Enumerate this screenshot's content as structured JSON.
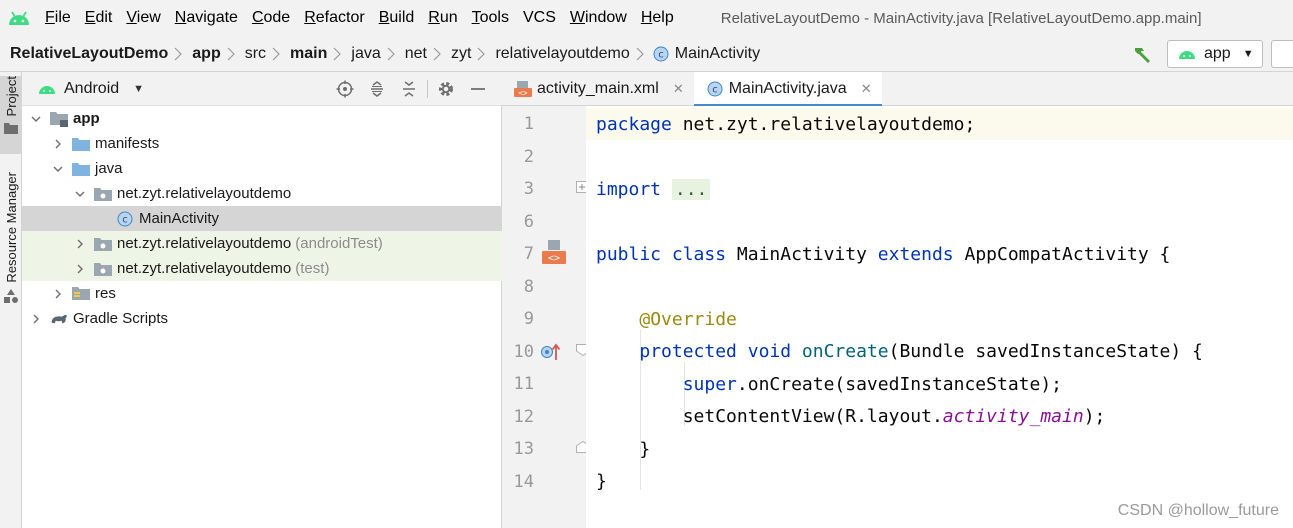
{
  "menu": {
    "items": [
      {
        "label": "File",
        "mnemonic": "F",
        "rest": "ile"
      },
      {
        "label": "Edit",
        "mnemonic": "E",
        "rest": "dit"
      },
      {
        "label": "View",
        "mnemonic": "V",
        "rest": "iew"
      },
      {
        "label": "Navigate",
        "mnemonic": "N",
        "rest": "avigate"
      },
      {
        "label": "Code",
        "mnemonic": "C",
        "rest": "ode"
      },
      {
        "label": "Refactor",
        "mnemonic": "R",
        "rest": "efactor"
      },
      {
        "label": "Build",
        "mnemonic": "B",
        "rest": "uild"
      },
      {
        "label": "Run",
        "mnemonic": "R",
        "rest": "un"
      },
      {
        "label": "Tools",
        "mnemonic": "T",
        "rest": "ools"
      },
      {
        "label": "VCS",
        "mnemonic": "",
        "rest": "VCS"
      },
      {
        "label": "Window",
        "mnemonic": "W",
        "rest": "indow"
      },
      {
        "label": "Help",
        "mnemonic": "H",
        "rest": "elp"
      }
    ],
    "window_title": "RelativeLayoutDemo - MainActivity.java [RelativeLayoutDemo.app.main]"
  },
  "breadcrumb": {
    "items": [
      "RelativeLayoutDemo",
      "app",
      "src",
      "main",
      "java",
      "net",
      "zyt",
      "relativelayoutdemo"
    ],
    "current": "MainActivity",
    "run_config": "app"
  },
  "side_tabs": {
    "project": "Project",
    "resource_manager": "Resource Manager"
  },
  "project_panel": {
    "view_mode": "Android",
    "tree": [
      {
        "label": "app",
        "suffix": "",
        "depth": 0,
        "expanded": true,
        "icon": "module-folder-icon",
        "bold": true
      },
      {
        "label": "manifests",
        "suffix": "",
        "depth": 1,
        "expanded": false,
        "icon": "folder-icon"
      },
      {
        "label": "java",
        "suffix": "",
        "depth": 1,
        "expanded": true,
        "icon": "folder-icon"
      },
      {
        "label": "net.zyt.relativelayoutdemo",
        "suffix": "",
        "depth": 2,
        "expanded": true,
        "icon": "package-icon"
      },
      {
        "label": "MainActivity",
        "suffix": "",
        "depth": 3,
        "expanded": null,
        "icon": "class-icon",
        "selected": true
      },
      {
        "label": "net.zyt.relativelayoutdemo",
        "suffix": "(androidTest)",
        "depth": 2,
        "expanded": false,
        "icon": "package-icon",
        "test": true
      },
      {
        "label": "net.zyt.relativelayoutdemo",
        "suffix": "(test)",
        "depth": 2,
        "expanded": false,
        "icon": "package-icon",
        "test": true
      },
      {
        "label": "res",
        "suffix": "",
        "depth": 1,
        "expanded": false,
        "icon": "res-folder-icon"
      },
      {
        "label": "Gradle Scripts",
        "suffix": "",
        "depth": 0,
        "expanded": false,
        "icon": "gradle-icon"
      }
    ]
  },
  "editor": {
    "tabs": [
      {
        "label": "activity_main.xml",
        "icon": "xml-file-icon",
        "active": false
      },
      {
        "label": "MainActivity.java",
        "icon": "class-icon",
        "active": true
      }
    ],
    "lines": [
      {
        "no": "1",
        "tokens": [
          {
            "t": "package ",
            "c": "kw"
          },
          {
            "t": "net.zyt.relativelayoutdemo;",
            "c": "plain"
          }
        ]
      },
      {
        "no": "2",
        "tokens": []
      },
      {
        "no": "3",
        "tokens": [
          {
            "t": "import ",
            "c": "kw"
          },
          {
            "t": "...",
            "c": "fold-dots"
          }
        ]
      },
      {
        "no": "6",
        "tokens": []
      },
      {
        "no": "7",
        "tokens": [
          {
            "t": "public class ",
            "c": "kw"
          },
          {
            "t": "MainActivity ",
            "c": "plain"
          },
          {
            "t": "extends ",
            "c": "kw"
          },
          {
            "t": "AppCompatActivity {",
            "c": "plain"
          }
        ]
      },
      {
        "no": "8",
        "tokens": []
      },
      {
        "no": "9",
        "tokens": [
          {
            "t": "    ",
            "c": "plain"
          },
          {
            "t": "@Override",
            "c": "ann"
          }
        ]
      },
      {
        "no": "10",
        "tokens": [
          {
            "t": "    ",
            "c": "plain"
          },
          {
            "t": "protected void ",
            "c": "kw"
          },
          {
            "t": "onCreate",
            "c": "fn"
          },
          {
            "t": "(Bundle savedInstanceState) {",
            "c": "plain"
          }
        ]
      },
      {
        "no": "11",
        "tokens": [
          {
            "t": "        ",
            "c": "plain"
          },
          {
            "t": "super",
            "c": "kw"
          },
          {
            "t": ".onCreate(savedInstanceState);",
            "c": "plain"
          }
        ]
      },
      {
        "no": "12",
        "tokens": [
          {
            "t": "        ",
            "c": "plain"
          },
          {
            "t": "setContentView(R.layout.",
            "c": "plain"
          },
          {
            "t": "activity_main",
            "c": "fieldref"
          },
          {
            "t": ");",
            "c": "plain"
          }
        ]
      },
      {
        "no": "13",
        "tokens": [
          {
            "t": "    ",
            "c": "plain"
          },
          {
            "t": "}",
            "c": "plain"
          }
        ]
      },
      {
        "no": "14",
        "tokens": [
          {
            "t": "}",
            "c": "plain"
          }
        ]
      }
    ]
  },
  "watermark": "CSDN @hollow_future",
  "colors": {
    "android_green": "#3ddc84",
    "folder_blue": "#7fb4e0",
    "class_blue": "#3e86c7",
    "active_tab_underline": "#4a88c7",
    "selected_row": "#d5d5d5",
    "test_row": "#eef5e6",
    "keyword": "#0033b3",
    "annotation": "#9e880d",
    "method": "#00627a",
    "field": "#871094"
  }
}
